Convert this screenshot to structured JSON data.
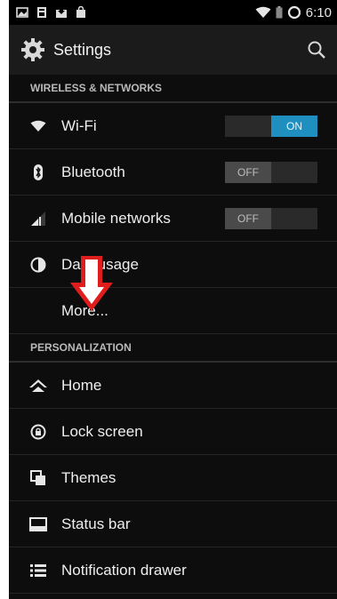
{
  "status_bar": {
    "time": "6:10"
  },
  "action_bar": {
    "title": "Settings"
  },
  "sections": {
    "wireless": "WIRELESS & NETWORKS",
    "personalization": "PERSONALIZATION"
  },
  "wireless_items": [
    {
      "label": "Wi-Fi",
      "toggle": "ON",
      "icon": "wifi-icon"
    },
    {
      "label": "Bluetooth",
      "toggle": "OFF",
      "icon": "bluetooth-icon"
    },
    {
      "label": "Mobile networks",
      "toggle": "OFF",
      "icon": "signal-icon"
    },
    {
      "label": "Data usage",
      "icon": "data-usage-icon"
    },
    {
      "label": "More..."
    }
  ],
  "personalization_items": [
    {
      "label": "Home",
      "icon": "home-icon"
    },
    {
      "label": "Lock screen",
      "icon": "lock-icon"
    },
    {
      "label": "Themes",
      "icon": "themes-icon"
    },
    {
      "label": "Status bar",
      "icon": "status-bar-icon"
    },
    {
      "label": "Notification drawer",
      "icon": "notification-drawer-icon"
    }
  ],
  "colors": {
    "accent": "#1f8fbf",
    "arrow": "#e01d1d",
    "background": "#0d0d0d"
  }
}
